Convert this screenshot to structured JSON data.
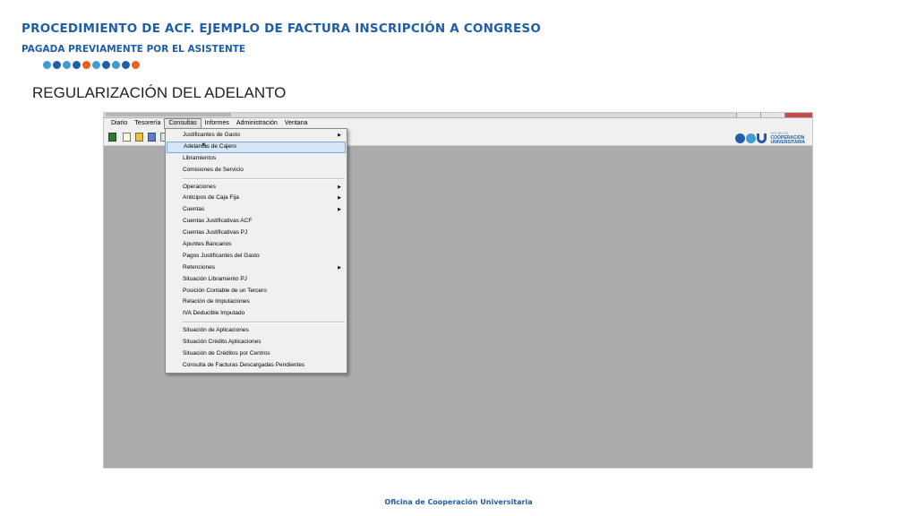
{
  "slide": {
    "title": "PROCEDIMIENTO DE ACF. EJEMPLO DE FACTURA INSCRIPCIÓN A CONGRESO",
    "subtitle": "PAGADA PREVIAMENTE POR EL ASISTENTE",
    "section_title": "REGULARIZACIÓN DEL ADELANTO",
    "footer": "Oficina de Cooperación Universitaria",
    "dot_colors": [
      "#3f9bd6",
      "#1f5ea8",
      "#3f9bd6",
      "#1f5ea8",
      "#e8601c",
      "#3f9bd6",
      "#1f5ea8",
      "#3f9bd6",
      "#1f5ea8",
      "#e8601c"
    ]
  },
  "app": {
    "menubar": [
      "Diario",
      "Tesorería",
      "Consultas",
      "Informes",
      "Administración",
      "Ventana"
    ],
    "active_menu": "Consultas",
    "toolbar_icons": [
      "calculator-icon",
      "new-document-icon",
      "open-folder-icon",
      "save-icon",
      "help-icon"
    ],
    "logo": {
      "line1": "OFICINA DE",
      "line2": "COOPERACIÓN",
      "line3": "UNIVERSITARIA"
    },
    "dropdown": {
      "group1": [
        {
          "label": "Justificantes de Gasto",
          "submenu": true
        },
        {
          "label": "Adelantos de Cajero",
          "submenu": false,
          "highlighted": true
        },
        {
          "label": "Libramientos",
          "submenu": false
        },
        {
          "label": "Comisiones de Servicio",
          "submenu": false
        }
      ],
      "group2": [
        {
          "label": "Operaciones",
          "submenu": true
        },
        {
          "label": "Anticipos de Caja Fija",
          "submenu": true
        },
        {
          "label": "Cuentas",
          "submenu": true
        },
        {
          "label": "Cuentas Justificativas ACF",
          "submenu": false
        },
        {
          "label": "Cuentas Justificativas PJ",
          "submenu": false
        },
        {
          "label": "Apuntes Bancarios",
          "submenu": false
        },
        {
          "label": "Pagos Justificantes del Gasto",
          "submenu": false
        },
        {
          "label": "Retenciones",
          "submenu": true
        },
        {
          "label": "Situación Libramiento PJ",
          "submenu": false
        },
        {
          "label": "Posición Contable de un Tercero",
          "submenu": false
        },
        {
          "label": "Relación de Imputaciones",
          "submenu": false
        },
        {
          "label": "IVA Deducible Imputado",
          "submenu": false
        }
      ],
      "group3": [
        {
          "label": "Situación de Aplicaciones",
          "submenu": false
        },
        {
          "label": "Situación Crédito Aplicaciones",
          "submenu": false
        },
        {
          "label": "Situación de Créditos por Centros",
          "submenu": false
        },
        {
          "label": "Consulta de Facturas Descargadas Pendientes",
          "submenu": false
        }
      ],
      "submenu_arrow": "▶"
    }
  }
}
